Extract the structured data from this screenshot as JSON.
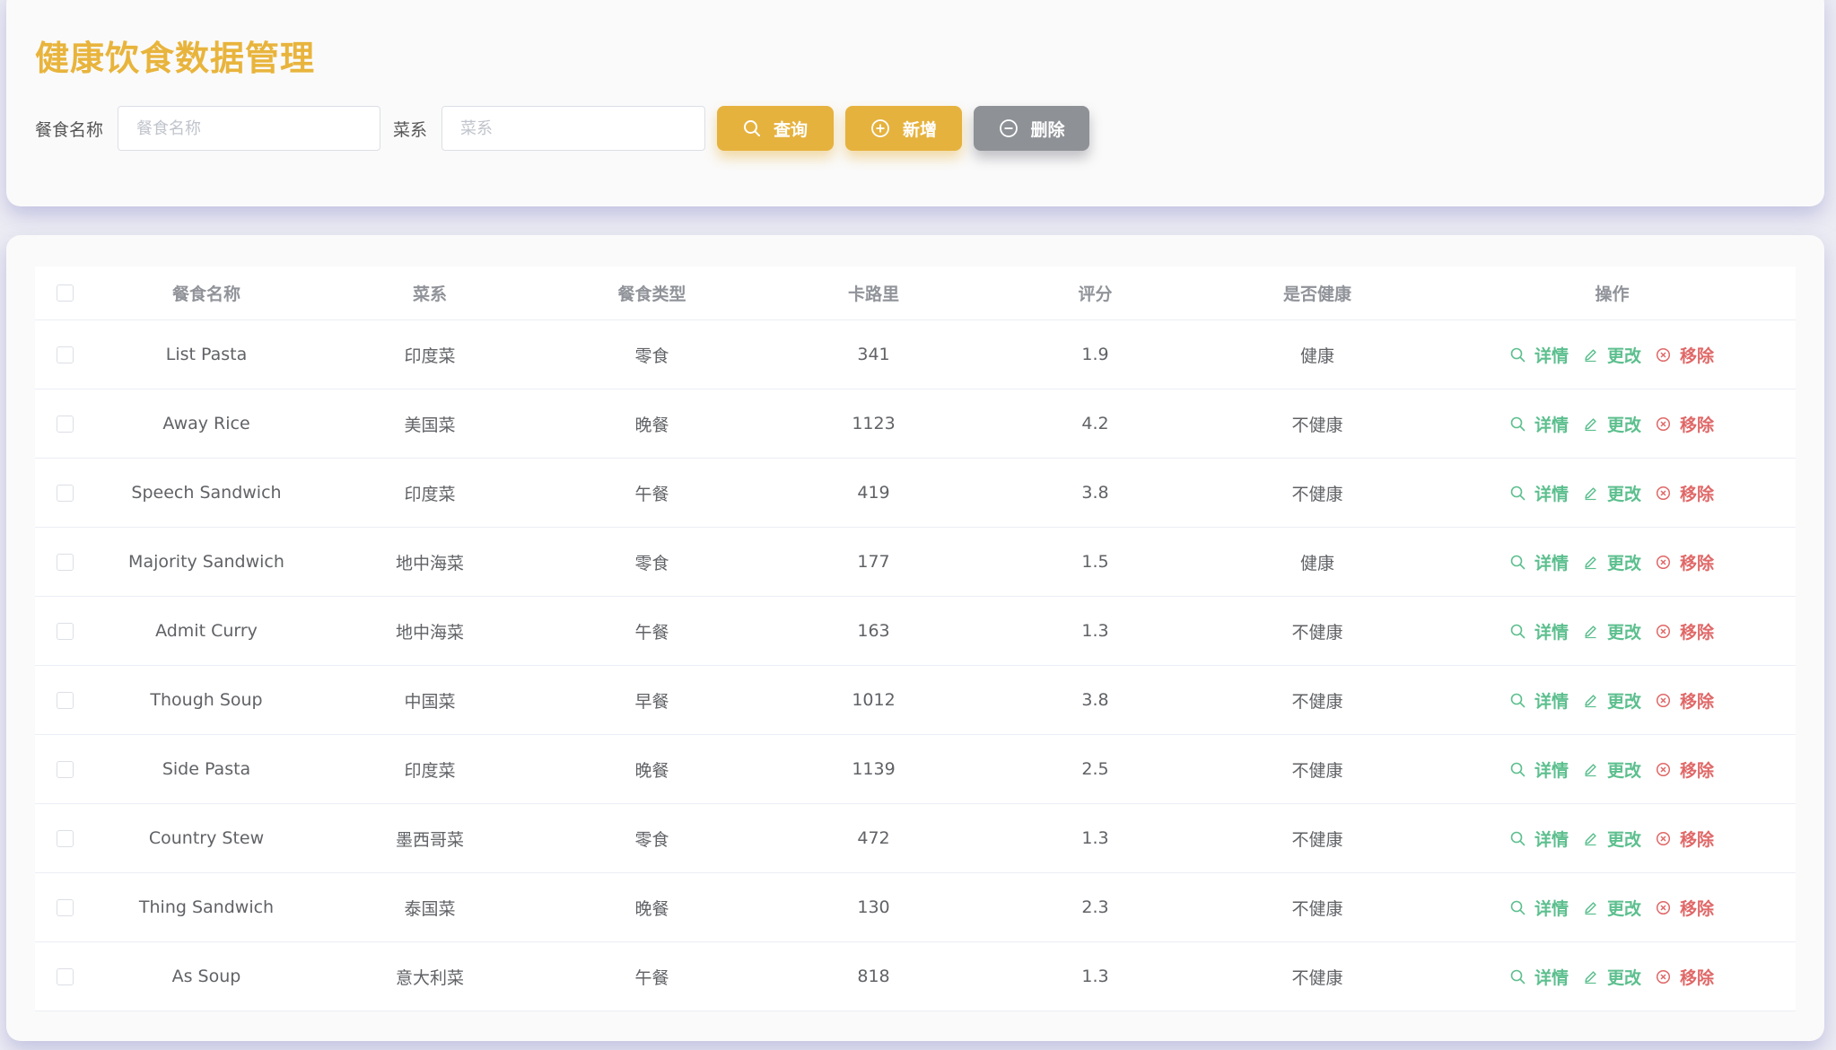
{
  "page": {
    "title": "健康饮食数据管理"
  },
  "search": {
    "name_label": "餐食名称",
    "name_placeholder": "餐食名称",
    "cuisine_label": "菜系",
    "cuisine_placeholder": "菜系",
    "query_label": "查询",
    "add_label": "新增",
    "delete_label": "删除"
  },
  "table": {
    "columns": [
      "餐食名称",
      "菜系",
      "餐食类型",
      "卡路里",
      "评分",
      "是否健康",
      "操作"
    ],
    "actions": {
      "detail": "详情",
      "edit": "更改",
      "remove": "移除"
    },
    "rows": [
      {
        "name": "List Pasta",
        "cuisine": "印度菜",
        "type": "零食",
        "calories": "341",
        "rating": "1.9",
        "healthy": "健康"
      },
      {
        "name": "Away Rice",
        "cuisine": "美国菜",
        "type": "晚餐",
        "calories": "1123",
        "rating": "4.2",
        "healthy": "不健康"
      },
      {
        "name": "Speech Sandwich",
        "cuisine": "印度菜",
        "type": "午餐",
        "calories": "419",
        "rating": "3.8",
        "healthy": "不健康"
      },
      {
        "name": "Majority Sandwich",
        "cuisine": "地中海菜",
        "type": "零食",
        "calories": "177",
        "rating": "1.5",
        "healthy": "健康"
      },
      {
        "name": "Admit Curry",
        "cuisine": "地中海菜",
        "type": "午餐",
        "calories": "163",
        "rating": "1.3",
        "healthy": "不健康"
      },
      {
        "name": "Though Soup",
        "cuisine": "中国菜",
        "type": "早餐",
        "calories": "1012",
        "rating": "3.8",
        "healthy": "不健康"
      },
      {
        "name": "Side Pasta",
        "cuisine": "印度菜",
        "type": "晚餐",
        "calories": "1139",
        "rating": "2.5",
        "healthy": "不健康"
      },
      {
        "name": "Country Stew",
        "cuisine": "墨西哥菜",
        "type": "零食",
        "calories": "472",
        "rating": "1.3",
        "healthy": "不健康"
      },
      {
        "name": "Thing Sandwich",
        "cuisine": "泰国菜",
        "type": "晚餐",
        "calories": "130",
        "rating": "2.3",
        "healthy": "不健康"
      },
      {
        "name": "As Soup",
        "cuisine": "意大利菜",
        "type": "午餐",
        "calories": "818",
        "rating": "1.3",
        "healthy": "不健康"
      }
    ]
  },
  "colors": {
    "accent": "#e6b23e",
    "action_green": "#5cbf8e",
    "action_red": "#e06868",
    "gray_button": "#8e9196"
  }
}
